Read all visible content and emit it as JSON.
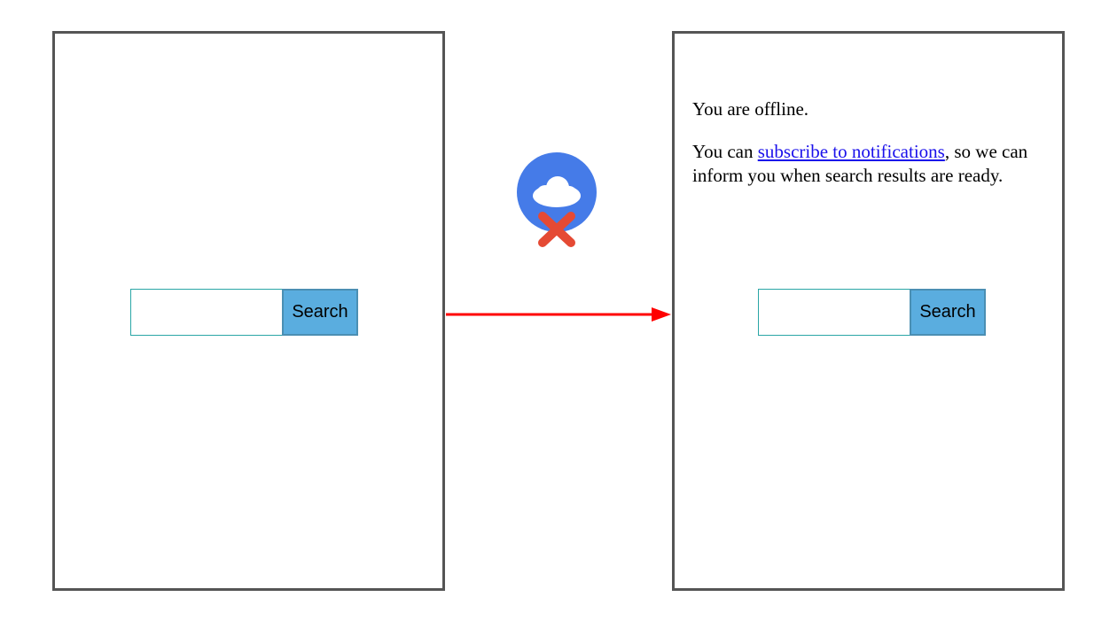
{
  "left": {
    "search": {
      "value": "",
      "button": "Search"
    }
  },
  "right": {
    "offline": {
      "line1": "You are offline.",
      "line2_pre": "You can ",
      "link": "subscribe to notifications",
      "line2_post": ", so we can inform you when search results are ready."
    },
    "search": {
      "value": "",
      "button": "Search"
    }
  },
  "icons": {
    "offline_cloud": "cloud-offline-icon",
    "arrow": "arrow-right-icon"
  },
  "colors": {
    "panel_border": "#555555",
    "button_bg": "#5aaddf",
    "button_border": "#4b8fb3",
    "input_border": "#2aa6a6",
    "arrow": "#ff0000",
    "cloud_bg": "#457be8",
    "cloud_fg": "#ffffff",
    "x_color": "#e54a34",
    "link": "#1a10eb"
  }
}
